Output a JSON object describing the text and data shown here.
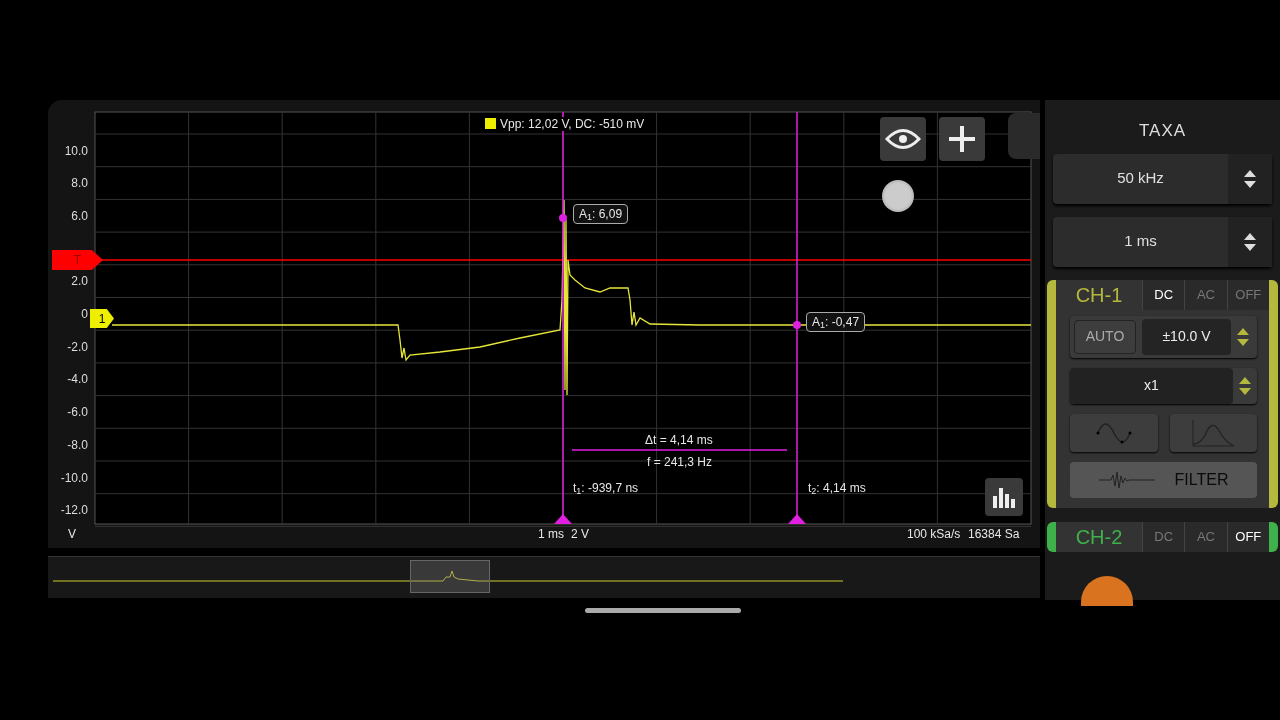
{
  "plot": {
    "measurement": "Vpp: 12,02 V, DC: -510 mV",
    "y_labels": [
      "10.0",
      "8.0",
      "6.0",
      "2.0",
      "0",
      "-2.0",
      "-4.0",
      "-6.0",
      "-8.0",
      "-10.0",
      "-12.0"
    ],
    "y_unit": "V",
    "trigger_marker": "T",
    "channel_marker": "1",
    "cursors": [
      {
        "readout": "A$_{1}$: 6,09",
        "time": "t$_{1}$: -939,7 ns"
      },
      {
        "readout": "A$_{1}$: -0,47",
        "time": "t$_{2}$: 4,14 ms"
      }
    ],
    "delta_t": "Δt = 4,14 ms",
    "frequency": "f = 241,3 Hz",
    "time_scale": "1 ms",
    "volt_scale": "2 V",
    "sample_rate": "100 kSa/s",
    "sample_count": "16384 Sa"
  },
  "timebase": {
    "title": "TAXA",
    "sample_rate": "50 kHz",
    "time_div": "1 ms"
  },
  "channels": [
    {
      "name": "CH-1",
      "color": "#b4b83c",
      "expanded": true,
      "couplings": [
        {
          "label": "DC",
          "selected": true
        },
        {
          "label": "AC",
          "selected": false
        },
        {
          "label": "OFF",
          "selected": false
        }
      ],
      "auto": "AUTO",
      "range": "±10.0 V",
      "probe": "x1",
      "filter": "FILTER"
    },
    {
      "name": "CH-2",
      "color": "#3fb14a",
      "expanded": false,
      "couplings": [
        {
          "label": "DC",
          "selected": false
        },
        {
          "label": "AC",
          "selected": false
        },
        {
          "label": "OFF",
          "selected": true
        }
      ]
    }
  ]
}
